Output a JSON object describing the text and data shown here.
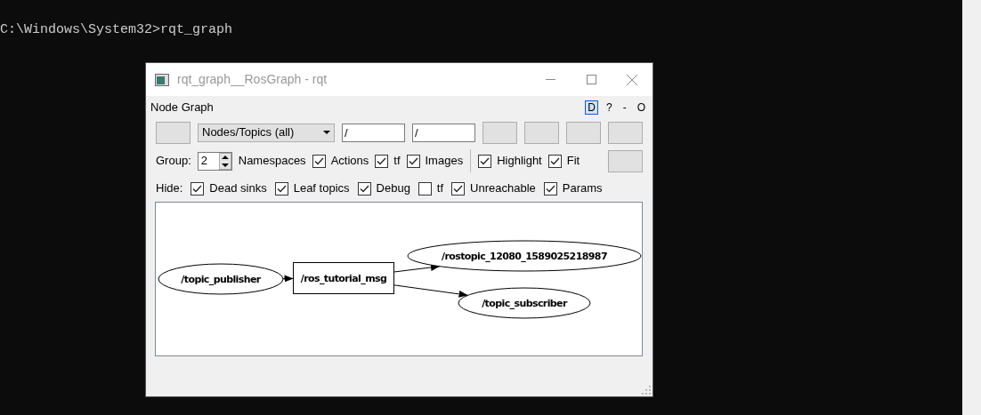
{
  "terminal": {
    "command_line": "C:\\Windows\\System32>rqt_graph"
  },
  "window": {
    "title": "rqt_graph__RosGraph - rqt"
  },
  "plugin": {
    "title": "Node Graph",
    "header_buttons": [
      {
        "label": "D",
        "selected": true
      },
      {
        "label": "?",
        "selected": false
      },
      {
        "label": "-",
        "selected": false
      },
      {
        "label": "O",
        "selected": false
      }
    ]
  },
  "toolbar": {
    "graph_type": "Nodes/Topics (all)",
    "node_filter": "/",
    "topic_filter": "/"
  },
  "options": {
    "group_label": "Group:",
    "group_value": "2",
    "namespaces_label": "Namespaces",
    "checks": [
      {
        "label": "Actions",
        "checked": true
      },
      {
        "label": "tf",
        "checked": true
      },
      {
        "label": "Images",
        "checked": true
      }
    ],
    "view_checks": [
      {
        "label": "Highlight",
        "checked": true
      },
      {
        "label": "Fit",
        "checked": true
      }
    ]
  },
  "hide": {
    "label": "Hide:",
    "checks": [
      {
        "label": "Dead sinks",
        "checked": true
      },
      {
        "label": "Leaf topics",
        "checked": true
      },
      {
        "label": "Debug",
        "checked": true
      },
      {
        "label": "tf",
        "checked": false
      },
      {
        "label": "Unreachable",
        "checked": true
      },
      {
        "label": "Params",
        "checked": true
      }
    ]
  },
  "graph": {
    "nodes": [
      {
        "label": "/topic_publisher",
        "kind": "ellipse"
      },
      {
        "label": "/ros_tutorial_msg",
        "kind": "box"
      },
      {
        "label": "/rostopic_12080_1589025218987",
        "kind": "ellipse"
      },
      {
        "label": "/topic_subscriber",
        "kind": "ellipse"
      }
    ]
  }
}
